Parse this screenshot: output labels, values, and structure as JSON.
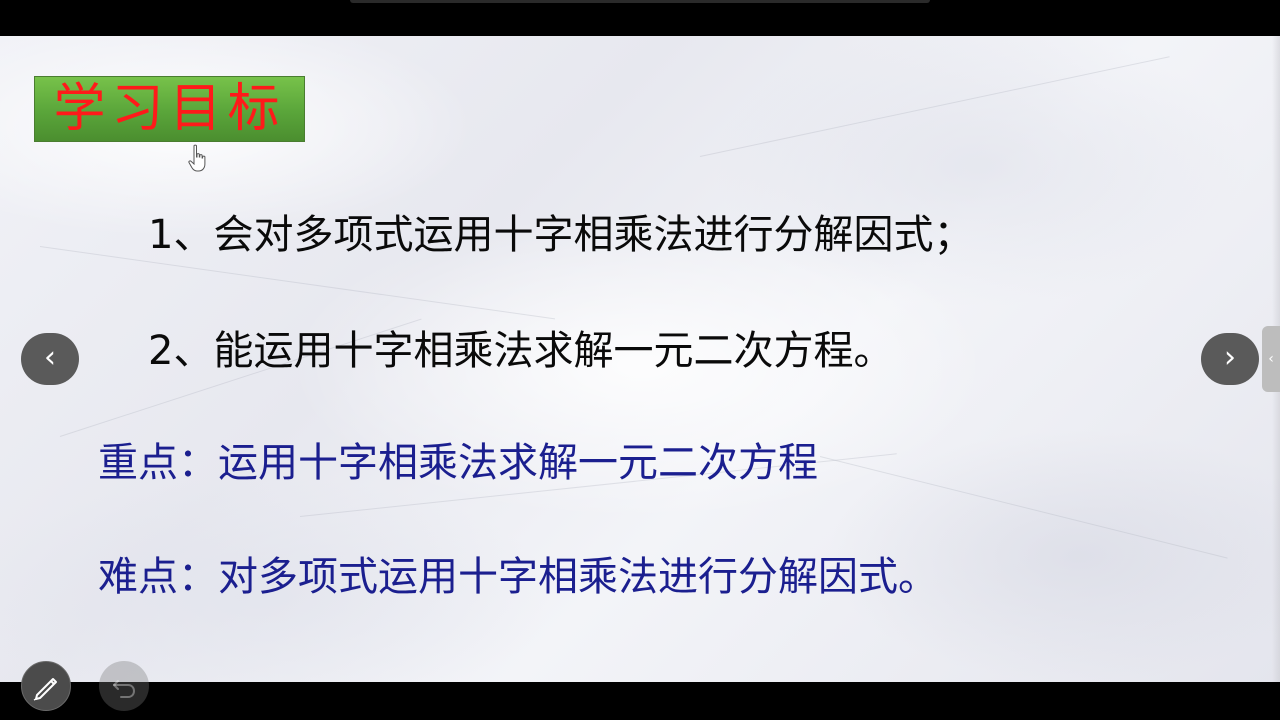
{
  "slide": {
    "title": "学习目标",
    "objectives": [
      "1、会对多项式运用十字相乘法进行分解因式；",
      "2、能运用十字相乘法求解一元二次方程。"
    ],
    "key_point": "重点：运用十字相乘法求解一元二次方程",
    "difficult_point": "难点：对多项式运用十字相乘法进行分解因式。"
  },
  "controls": {
    "prev_icon": "‹",
    "next_icon": "›",
    "side_tab_icon": "‹",
    "pen_icon": "pen-icon",
    "undo_icon": "undo-icon"
  },
  "colors": {
    "title_text": "#ff1a1a",
    "title_bg": "#5aa53a",
    "objective_text": "#0a0a0a",
    "point_text": "#1b1f8f",
    "nav_button_bg": "#5a5a5a"
  }
}
